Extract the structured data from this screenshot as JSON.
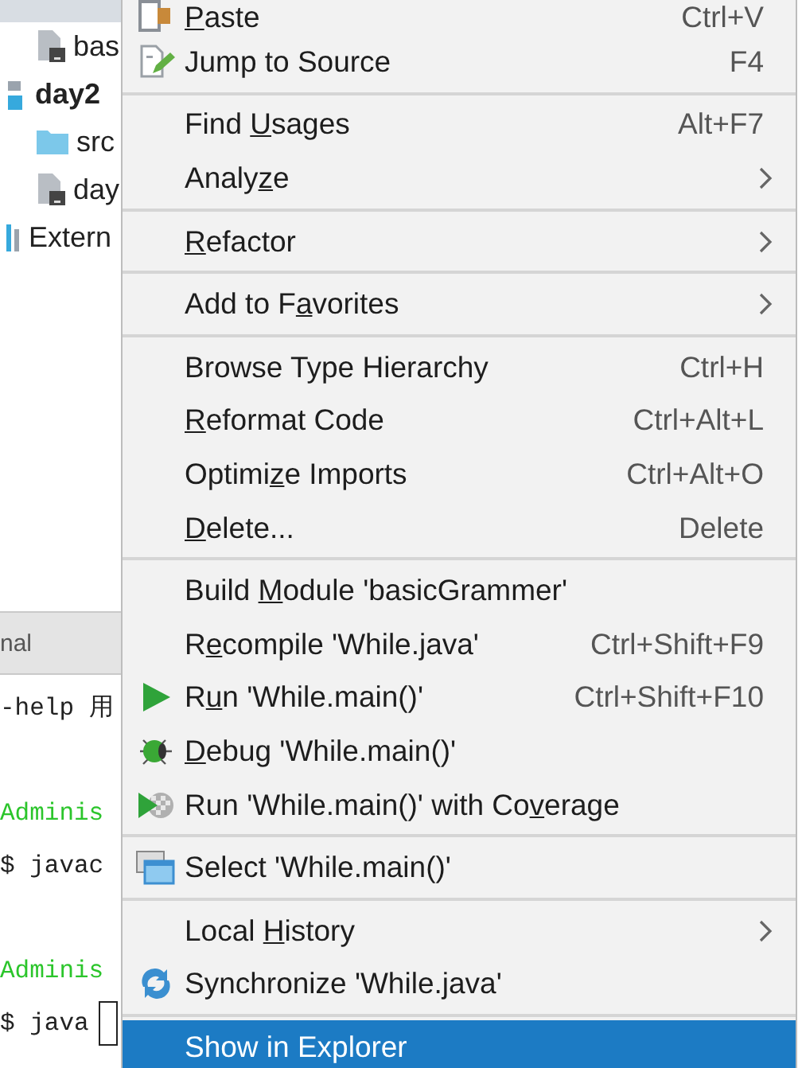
{
  "project_tree": [
    {
      "kind": "group",
      "children": [
        {
          "label": "bas",
          "kind": "file"
        }
      ]
    },
    {
      "label": "day2",
      "kind": "module",
      "children": [
        {
          "label": "src",
          "kind": "folder"
        },
        {
          "label": "day",
          "kind": "file"
        }
      ]
    },
    {
      "label": "Extern",
      "kind": "library"
    }
  ],
  "terminal": {
    "tab_title": "nal",
    "lines": [
      {
        "kind": "output",
        "text": "-help 用"
      },
      {
        "kind": "prompt",
        "text": "Adminis"
      },
      {
        "kind": "command",
        "text": "$ javac",
        "cursor": false
      },
      {
        "kind": "prompt",
        "text": "Adminis"
      },
      {
        "kind": "command",
        "text": "$ java",
        "cursor": true
      }
    ]
  },
  "context_menu": [
    {
      "kind": "paste",
      "mnemonic": "P",
      "rest": "aste",
      "shortcut": "Ctrl+V",
      "submenu": false,
      "selected": false
    },
    {
      "kind": "jump",
      "label": "Jump to Source",
      "shortcut": "F4",
      "submenu": false,
      "selected": false
    },
    {
      "kind": "separator"
    },
    {
      "kind": "item",
      "label": "Find ",
      "mnemonic": "U",
      "rest": "sages",
      "shortcut": "Alt+F7",
      "submenu": false,
      "selected": false
    },
    {
      "kind": "item",
      "label": "Analy",
      "mnemonic": "z",
      "rest": "e",
      "submenu": true,
      "selected": false
    },
    {
      "kind": "separator"
    },
    {
      "kind": "item",
      "mnemonic": "R",
      "rest": "efactor",
      "submenu": true,
      "selected": false
    },
    {
      "kind": "separator"
    },
    {
      "kind": "item",
      "label": "Add to F",
      "mnemonic": "a",
      "rest": "vorites",
      "submenu": true,
      "selected": false
    },
    {
      "kind": "separator"
    },
    {
      "kind": "item",
      "label": "Browse Type Hierarchy",
      "shortcut": "Ctrl+H",
      "submenu": false,
      "selected": false
    },
    {
      "kind": "item",
      "mnemonic": "R",
      "rest": "eformat Code",
      "shortcut": "Ctrl+Alt+L",
      "submenu": false,
      "selected": false
    },
    {
      "kind": "item",
      "label": "Optimi",
      "mnemonic": "z",
      "rest": "e Imports",
      "shortcut": "Ctrl+Alt+O",
      "submenu": false,
      "selected": false
    },
    {
      "kind": "item",
      "mnemonic": "D",
      "rest": "elete...",
      "shortcut": "Delete",
      "submenu": false,
      "selected": false
    },
    {
      "kind": "separator"
    },
    {
      "kind": "item",
      "label": "Build ",
      "mnemonic": "M",
      "rest": "odule 'basicGrammer'",
      "submenu": false,
      "selected": false
    },
    {
      "kind": "item",
      "label": "R",
      "mnemonic": "e",
      "rest": "compile 'While.java'",
      "shortcut": "Ctrl+Shift+F9",
      "submenu": false,
      "selected": false
    },
    {
      "kind": "run",
      "label": "R",
      "mnemonic": "u",
      "rest": "n 'While.main()'",
      "shortcut": "Ctrl+Shift+F10",
      "submenu": false,
      "selected": false
    },
    {
      "kind": "debug",
      "mnemonic": "D",
      "rest": "ebug 'While.main()'",
      "submenu": false,
      "selected": false
    },
    {
      "kind": "coverage",
      "label": "Run 'While.main()' with Co",
      "mnemonic": "v",
      "rest": "erage",
      "submenu": false,
      "selected": false
    },
    {
      "kind": "separator"
    },
    {
      "kind": "select",
      "label": "Select 'While.main()'",
      "submenu": false,
      "selected": false
    },
    {
      "kind": "separator"
    },
    {
      "kind": "item",
      "label": "Local ",
      "mnemonic": "H",
      "rest": "istory",
      "submenu": true,
      "selected": false
    },
    {
      "kind": "sync",
      "label": "Synchronize 'While.java'",
      "submenu": false,
      "selected": false
    },
    {
      "kind": "separator"
    },
    {
      "kind": "item",
      "label": "Show in Explorer",
      "submenu": false,
      "selected": true
    }
  ]
}
